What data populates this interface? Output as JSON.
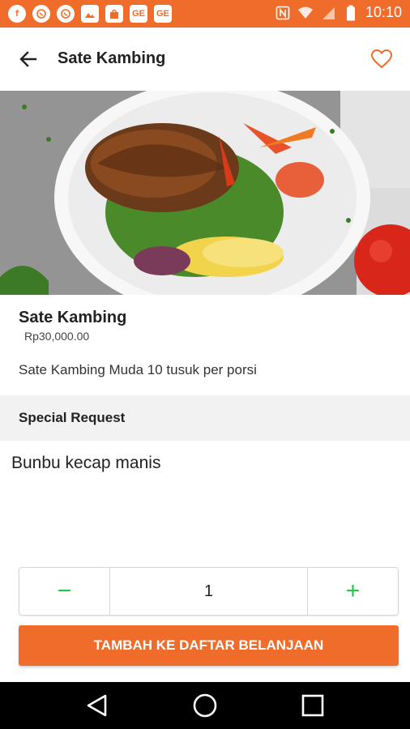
{
  "status_bar": {
    "time": "10:10",
    "notification_icons": [
      "facebook-icon",
      "whatsapp-icon",
      "whatsapp-icon",
      "image-icon",
      "shopping-bag-icon",
      "ge-icon",
      "ge-icon"
    ],
    "system_icons": [
      "nfc-icon",
      "wifi-icon",
      "signal-icon",
      "battery-icon"
    ],
    "ge_label": "GE",
    "color": "#ef6c2b"
  },
  "header": {
    "title": "Sate Kambing",
    "back_icon": "arrow-left-icon",
    "favorite_icon": "heart-outline-icon"
  },
  "product": {
    "name": "Sate Kambing",
    "price": "Rp30,000.00",
    "description": "Sate Kambing Muda 10 tusuk per porsi"
  },
  "special_request": {
    "label": "Special Request",
    "value": "Bunbu kecap manis"
  },
  "quantity": {
    "minus_label": "−",
    "value": "1",
    "plus_label": "+"
  },
  "actions": {
    "add_to_cart_label": "TAMBAH KE DAFTAR BELANJAAN",
    "accent": "#ef6c2b",
    "stepper_accent": "#2bbf4f"
  },
  "navigation": {
    "items": [
      "back-triangle-icon",
      "home-circle-icon",
      "recents-square-icon"
    ]
  }
}
